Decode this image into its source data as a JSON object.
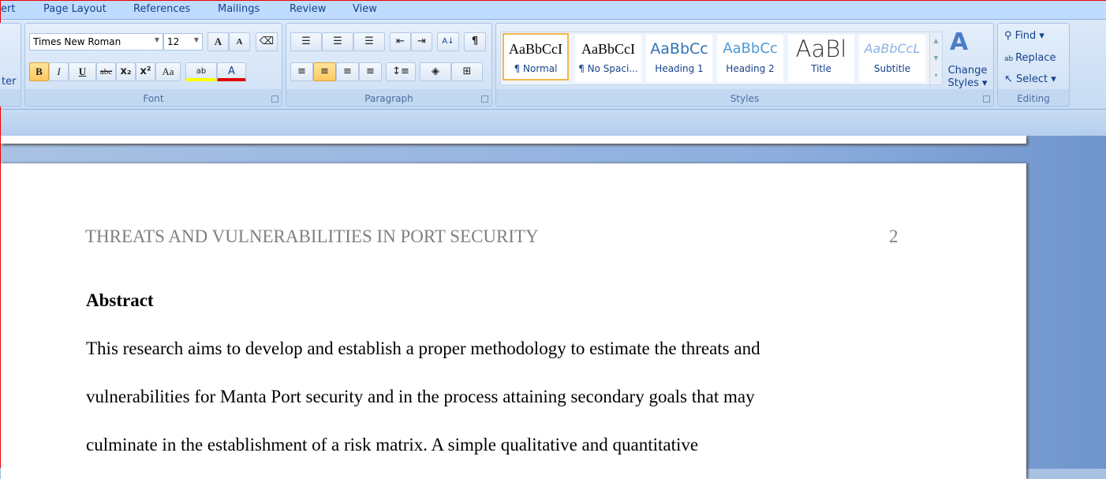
{
  "tabs": [
    "ert",
    "Page Layout",
    "References",
    "Mailings",
    "Review",
    "View"
  ],
  "font": {
    "name": "Times New Roman",
    "size": "12",
    "group_label": "Font",
    "grow": "A",
    "shrink": "A",
    "bold": "B",
    "italic": "I",
    "underline": "U",
    "strike": "abc",
    "sub": "x₂",
    "sup": "x²",
    "case": "Aa",
    "highlight": "ab",
    "color": "A",
    "highlight_color": "#ffff00",
    "font_color": "#e00000"
  },
  "clipboard": {
    "partial_label": "ter"
  },
  "paragraph": {
    "group_label": "Paragraph",
    "pilcrow": "¶",
    "sort": "A↓"
  },
  "styles": {
    "group_label": "Styles",
    "items": [
      {
        "preview": "AaBbCcI",
        "name": "¶ Normal"
      },
      {
        "preview": "AaBbCcI",
        "name": "¶ No Spaci..."
      },
      {
        "preview": "AaBbCc",
        "name": "Heading 1"
      },
      {
        "preview": "AaBbCc",
        "name": "Heading 2"
      },
      {
        "preview": "AaBl",
        "name": "Title"
      },
      {
        "preview": "AaBbCcL",
        "name": "Subtitle"
      }
    ],
    "change_styles": "Change Styles ▾"
  },
  "editing": {
    "group_label": "Editing",
    "find": "Find ▾",
    "replace": "Replace",
    "select": "Select ▾"
  },
  "document": {
    "header": "THREATS AND VULNERABILITIES IN PORT SECURITY",
    "page_number": "2",
    "heading": "Abstract",
    "lines": [
      "This research  aims to develop and establish a proper methodology to estimate the threats and",
      "vulnerabilities for Manta Port security and in the process attaining secondary goals that may",
      "culminate in the establishment of a risk matrix.  A simple qualitative and quantitative"
    ]
  }
}
